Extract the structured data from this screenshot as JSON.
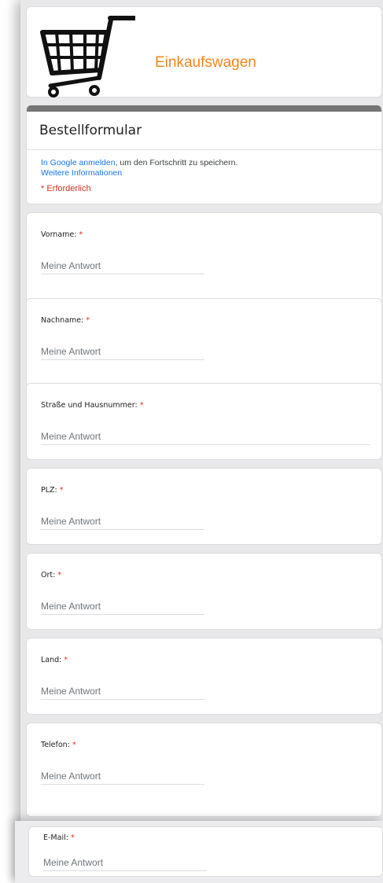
{
  "header": {
    "title": "Einkaufswagen",
    "icon": "shopping-cart-icon"
  },
  "form": {
    "title": "Bestellformular",
    "signin_link": "In Google anmelden",
    "signin_text": ", um den Fortschritt zu speichern.",
    "more_info": "Weitere Informationen",
    "required_note": "* Erforderlich"
  },
  "questions": [
    {
      "label": "Vorname:",
      "placeholder": "Meine Antwort"
    },
    {
      "label": "Nachname:",
      "placeholder": "Meine Antwort"
    },
    {
      "label": "Straße und Hausnummer:",
      "placeholder": "Meine Antwort"
    },
    {
      "label": "PLZ:",
      "placeholder": "Meine Antwort"
    },
    {
      "label": "Ort:",
      "placeholder": "Meine Antwort"
    },
    {
      "label": "Land:",
      "placeholder": "Meine Antwort"
    },
    {
      "label": "Telefon:",
      "placeholder": "Meine Antwort"
    },
    {
      "label": "E-Mail:",
      "placeholder": "Meine Antwort"
    }
  ],
  "required_star": "*",
  "colors": {
    "brand": "#f2851d",
    "link": "#1a73e8",
    "required": "#d93025",
    "form_bar": "#757575"
  }
}
